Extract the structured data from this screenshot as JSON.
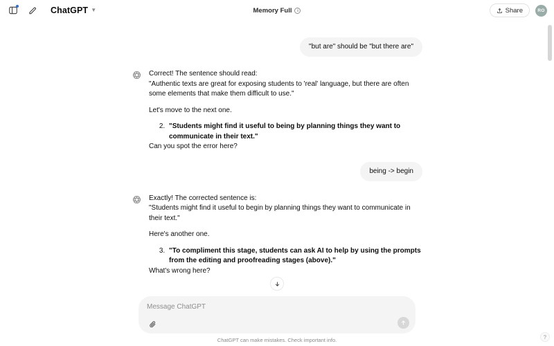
{
  "header": {
    "sidebar_toggle_icon": "sidebar-toggle-icon",
    "new_chat_icon": "compose-pencil-icon",
    "brand_name": "ChatGPT",
    "brand_chevron_icon": "chevron-down-icon",
    "memory_status": "Memory Full",
    "memory_info_icon": "info-circle-icon",
    "memory_info_glyph": "i",
    "share_label": "Share",
    "share_icon": "share-upload-icon",
    "avatar_initials": "RO",
    "avatar_color": "#9aaca8",
    "badge_dot_color": "#2f6fd0"
  },
  "conversation": {
    "messages": [
      {
        "role": "user",
        "text": "\"but are\" should be \"but there are\""
      },
      {
        "role": "assistant",
        "avatar_icon": "openai-logo-icon",
        "paragraphs": [
          "Correct! The sentence should read:",
          "\"Authentic texts are great for exposing students to 'real' language, but there are often some elements that make them difficult to use.\"",
          "Let's move to the next one."
        ],
        "list_start": 2,
        "list_items": [
          "\"Students might find it useful to being by planning things they want to communicate in their text.\""
        ],
        "closing": "Can you spot the error here?"
      },
      {
        "role": "user",
        "text": "being -> begin"
      },
      {
        "role": "assistant",
        "avatar_icon": "openai-logo-icon",
        "paragraphs": [
          "Exactly! The corrected sentence is:",
          "\"Students might find it useful to begin by planning things they want to communicate in their text.\"",
          "Here's another one."
        ],
        "list_start": 3,
        "list_items": [
          "\"To compliment this stage, students can ask AI to help by using the prompts from the editing and proofreading stages (above).\""
        ],
        "closing": "What's wrong here?"
      }
    ]
  },
  "scroll_down_button": {
    "icon": "arrow-down-icon"
  },
  "composer": {
    "placeholder": "Message ChatGPT",
    "attach_icon": "paperclip-icon",
    "send_icon": "arrow-up-icon",
    "send_enabled": false
  },
  "footer": {
    "disclaimer": "ChatGPT can make mistakes. Check important info."
  },
  "help": {
    "label": "?"
  }
}
